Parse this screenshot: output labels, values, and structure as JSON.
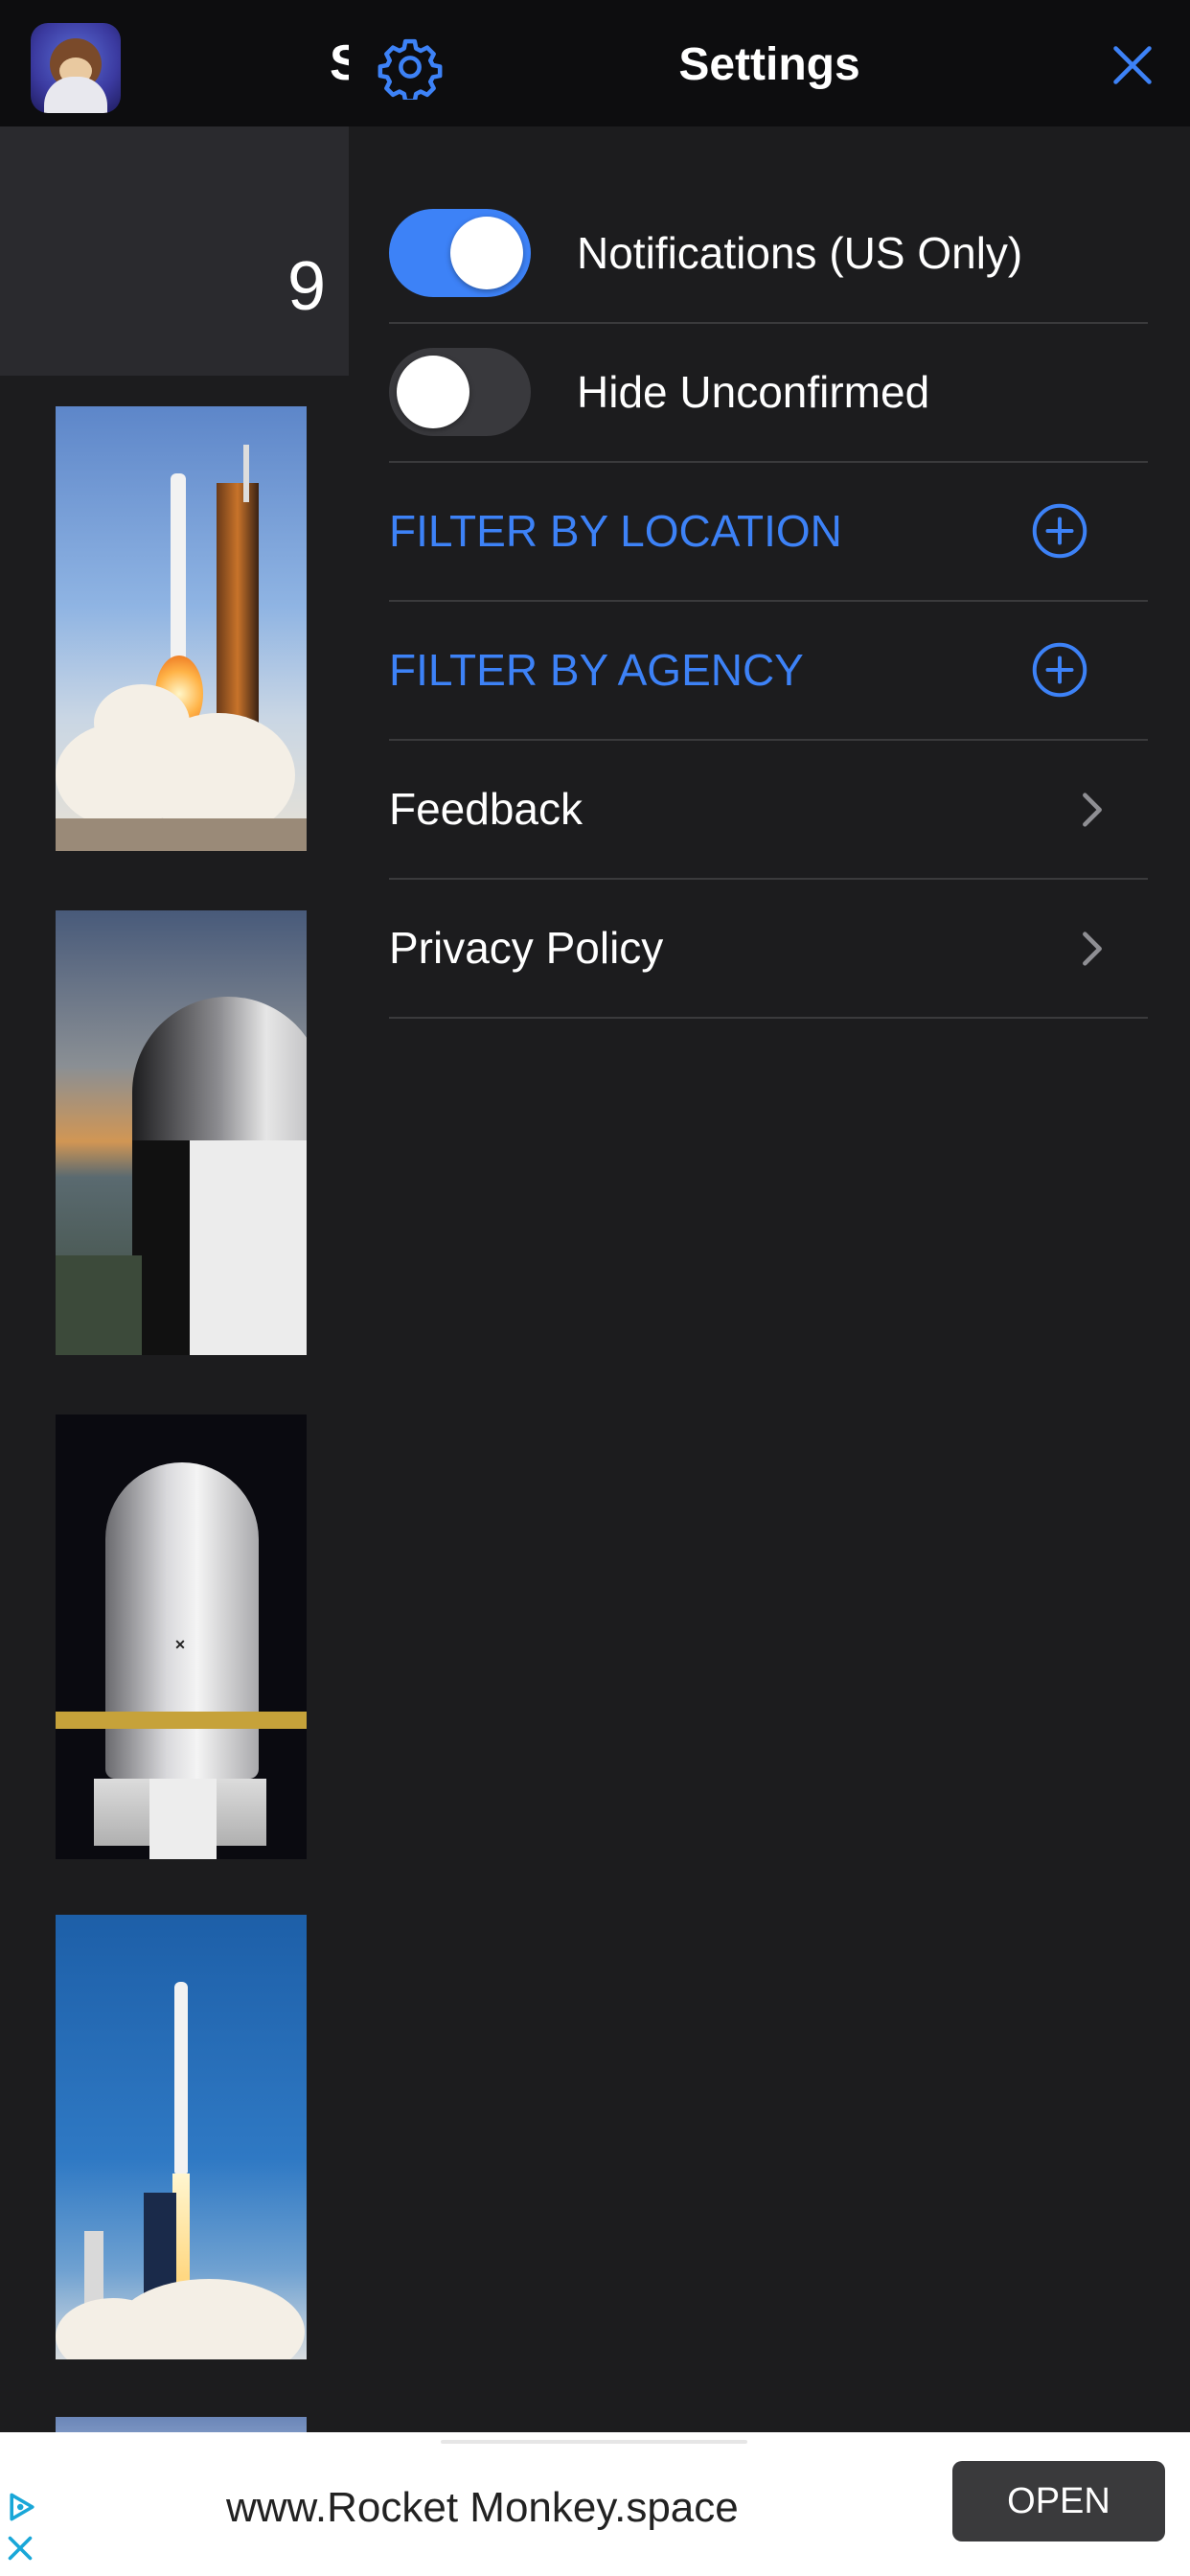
{
  "background_app": {
    "title_fragment": "S",
    "count": "9",
    "thumbnails": [
      "rocket-launch",
      "crew-capsule",
      "starlink-fairing",
      "rocket-liftoff",
      "rocket"
    ]
  },
  "settings": {
    "title": "Settings",
    "toggles": [
      {
        "label": "Notifications (US Only)",
        "on": true
      },
      {
        "label": "Hide Unconfirmed",
        "on": false
      }
    ],
    "filters": [
      {
        "label": "FILTER BY LOCATION",
        "icon": "plus-circle-icon"
      },
      {
        "label": "FILTER BY AGENCY",
        "icon": "plus-circle-icon"
      }
    ],
    "links": [
      {
        "label": "Feedback",
        "icon": "chevron-right-icon"
      },
      {
        "label": "Privacy Policy",
        "icon": "chevron-right-icon"
      }
    ]
  },
  "ad": {
    "text": "www.Rocket Monkey.space",
    "button": "OPEN"
  },
  "colors": {
    "accent": "#3d82f7",
    "panel_bg": "#1c1c1e",
    "header_bg": "#0d0d0f",
    "separator": "#3a3a3c",
    "toggle_off": "#39393d"
  }
}
